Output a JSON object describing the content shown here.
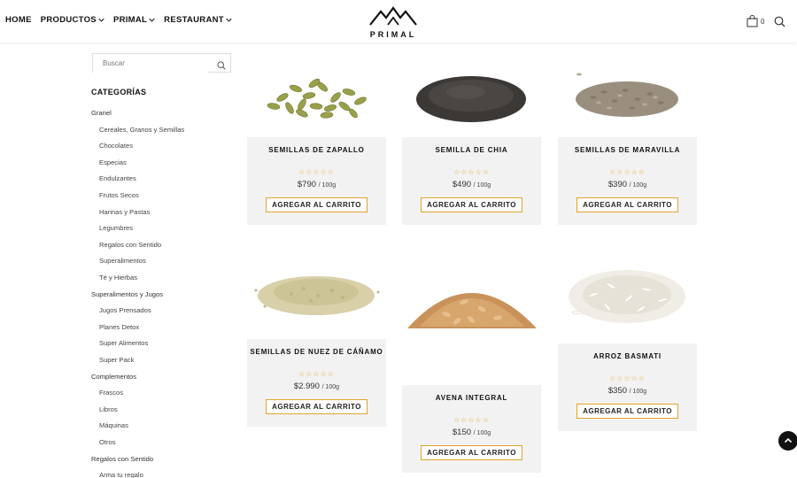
{
  "nav": {
    "items": [
      {
        "label": "HOME",
        "has_dropdown": false
      },
      {
        "label": "PRODUCTOS",
        "has_dropdown": true
      },
      {
        "label": "PRIMAL",
        "has_dropdown": true
      },
      {
        "label": "RESTAURANT",
        "has_dropdown": true
      }
    ],
    "logo_text": "PRIMAL",
    "cart_count": "0"
  },
  "sidebar": {
    "search_placeholder": "Buscar",
    "categories_title": "CATEGORÍAS",
    "categories": [
      {
        "label": "Granel",
        "level": 0
      },
      {
        "label": "Cereales, Granos y Semillas",
        "level": 1
      },
      {
        "label": "Chocolates",
        "level": 1
      },
      {
        "label": "Especias",
        "level": 1
      },
      {
        "label": "Endulzantes",
        "level": 1
      },
      {
        "label": "Frutos Secos",
        "level": 1
      },
      {
        "label": "Harinas y Pastas",
        "level": 1
      },
      {
        "label": "Legumbres",
        "level": 1
      },
      {
        "label": "Regalos con Sentido",
        "level": 1
      },
      {
        "label": "Superalimentos",
        "level": 1
      },
      {
        "label": "Té y Hierbas",
        "level": 1
      },
      {
        "label": "Superalimentos y Jugos",
        "level": 0
      },
      {
        "label": "Jugos Prensados",
        "level": 1
      },
      {
        "label": "Planes Detox",
        "level": 1
      },
      {
        "label": "Super Alimentos",
        "level": 1
      },
      {
        "label": "Super Pack",
        "level": 1
      },
      {
        "label": "Complementos",
        "level": 0
      },
      {
        "label": "Frascos",
        "level": 1
      },
      {
        "label": "Libros",
        "level": 1
      },
      {
        "label": "Máquinas",
        "level": 1
      },
      {
        "label": "Otros",
        "level": 1
      },
      {
        "label": "Regalos con Sentido",
        "level": 0
      },
      {
        "label": "Arma tu regalo",
        "level": 1
      }
    ]
  },
  "products": [
    {
      "name": "SEMILLAS DE ZAPALLO",
      "stars": "☆☆☆☆☆",
      "price": "$790",
      "unit": "/ 100g",
      "button": "AGREGAR AL CARRITO",
      "image": "pumpkin-seeds"
    },
    {
      "name": "SEMILLA DE CHIA",
      "stars": "☆☆☆☆☆",
      "price": "$490",
      "unit": "/ 100g",
      "button": "AGREGAR AL CARRITO",
      "image": "chia-seeds"
    },
    {
      "name": "SEMILLAS DE MARAVILLA",
      "stars": "☆☆☆☆☆",
      "price": "$390",
      "unit": "/ 100g",
      "button": "AGREGAR AL CARRITO",
      "image": "sunflower-seeds"
    },
    {
      "name": "SEMILLAS DE NUEZ DE CÁÑAMO",
      "stars": "☆☆☆☆☆",
      "price": "$2.990",
      "unit": "/ 100g",
      "button": "AGREGAR AL CARRITO",
      "image": "hemp-seeds"
    },
    {
      "name": "AVENA INTEGRAL",
      "stars": "☆☆☆☆☆",
      "price": "$150",
      "unit": "/ 100g",
      "button": "AGREGAR AL CARRITO",
      "image": "oats"
    },
    {
      "name": "ARROZ BASMATI",
      "stars": "☆☆☆☆☆",
      "price": "$350",
      "unit": "/ 100g",
      "button": "AGREGAR AL CARRITO",
      "image": "basmati-rice"
    }
  ],
  "colors": {
    "accent": "#e0a52a",
    "card_bg": "#f2f2f2",
    "text_dark": "#111111"
  }
}
